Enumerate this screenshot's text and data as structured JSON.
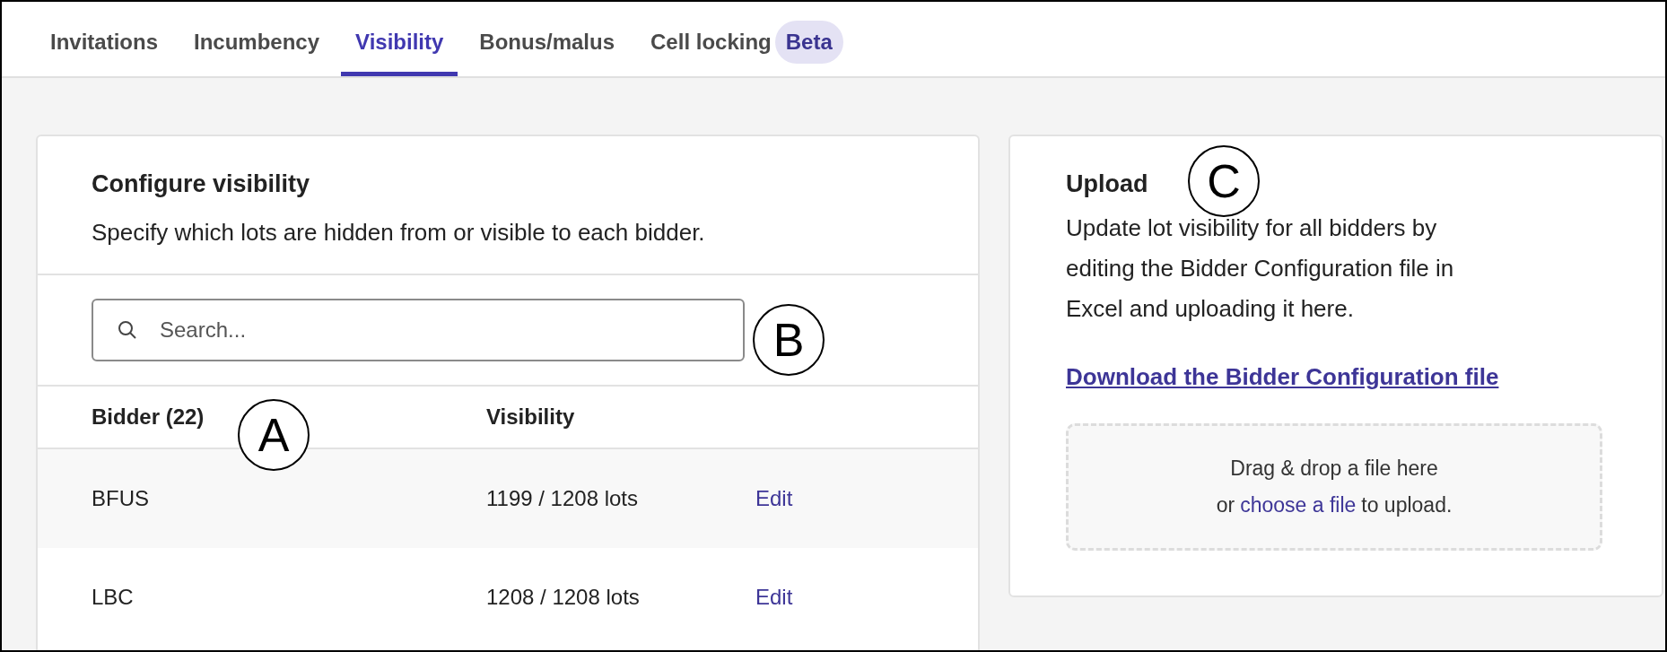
{
  "tabs": [
    {
      "label": "Invitations",
      "selected": false
    },
    {
      "label": "Incumbency",
      "selected": false
    },
    {
      "label": "Visibility",
      "selected": true
    },
    {
      "label": "Bonus/malus",
      "selected": false
    },
    {
      "label": "Cell locking",
      "selected": false,
      "badge": "Beta"
    }
  ],
  "configure": {
    "title": "Configure visibility",
    "description": "Specify which lots are hidden from or visible to each bidder.",
    "search": {
      "placeholder": "Search..."
    },
    "columns": [
      "Bidder (22)",
      "Visibility"
    ],
    "rows": [
      {
        "bidder": "BFUS",
        "visibility": "1199 / 1208 lots",
        "action": "Edit"
      },
      {
        "bidder": "LBC",
        "visibility": "1208 / 1208 lots",
        "action": "Edit"
      }
    ]
  },
  "upload": {
    "title": "Upload",
    "description": "Update lot visibility for all bidders by editing the Bidder Configuration file in Excel and uploading it here.",
    "download_link": "Download the Bidder Configuration file",
    "dropzone": {
      "line_1": "Drag & drop a file here",
      "prefix": "or",
      "link": "choose a file",
      "suffix": "to upload."
    }
  },
  "callouts": [
    "A",
    "B",
    "C"
  ]
}
